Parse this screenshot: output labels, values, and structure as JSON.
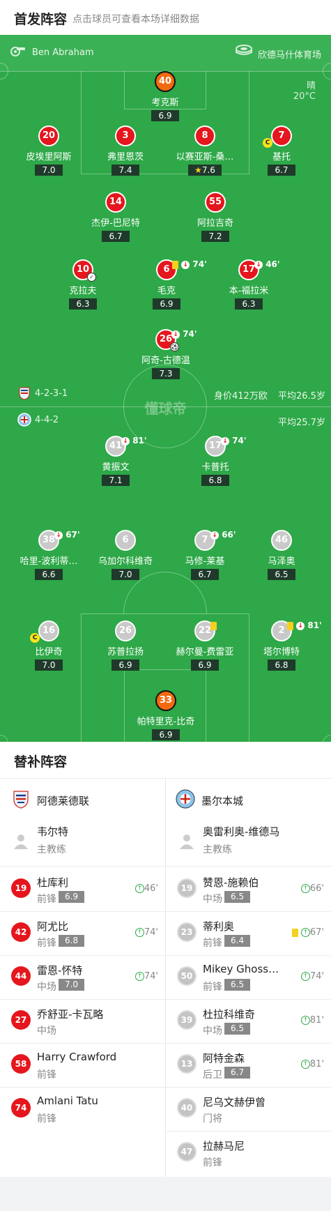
{
  "header": {
    "title": "首发阵容",
    "subtitle": "点击球员可查看本场详细数据"
  },
  "match_info": {
    "referee": "Ben Abraham",
    "venue": "欣德马什体育场",
    "weather": "晴",
    "temperature": "20°C"
  },
  "home": {
    "name": "阿德莱德联",
    "formation": "4-2-3-1",
    "value": "身价412万欧",
    "avg_age": "平均26.5岁",
    "players": [
      {
        "num": "40",
        "name": "考克斯",
        "rating": "6.9"
      },
      {
        "num": "20",
        "name": "皮埃里阿斯",
        "rating": "7.0"
      },
      {
        "num": "3",
        "name": "弗里恩茨",
        "rating": "7.4"
      },
      {
        "num": "8",
        "name": "以赛亚斯-桑…",
        "rating": "7.6"
      },
      {
        "num": "7",
        "name": "基托",
        "rating": "6.7"
      },
      {
        "num": "14",
        "name": "杰伊-巴尼特",
        "rating": "6.7"
      },
      {
        "num": "55",
        "name": "阿拉吉奇",
        "rating": "7.2"
      },
      {
        "num": "10",
        "name": "克拉夫",
        "rating": "6.3"
      },
      {
        "num": "6",
        "name": "毛克",
        "rating": "6.9",
        "event": "74'"
      },
      {
        "num": "17",
        "name": "本-福拉米",
        "rating": "6.3",
        "event": "46'"
      },
      {
        "num": "26",
        "name": "阿奇-古德温",
        "rating": "7.3",
        "event": "74'"
      }
    ]
  },
  "away": {
    "name": "墨尔本城",
    "formation": "4-4-2",
    "avg_age": "平均25.7岁",
    "players": [
      {
        "num": "41",
        "name": "黄振文",
        "rating": "7.1",
        "event": "81'"
      },
      {
        "num": "17",
        "name": "卡普托",
        "rating": "6.8",
        "event": "74'"
      },
      {
        "num": "38",
        "name": "哈里-波利蒂…",
        "rating": "6.6",
        "event": "67'"
      },
      {
        "num": "6",
        "name": "乌加尔科维奇",
        "rating": "7.0"
      },
      {
        "num": "7",
        "name": "马修-莱基",
        "rating": "6.7",
        "event": "66'"
      },
      {
        "num": "46",
        "name": "马泽奥",
        "rating": "6.5"
      },
      {
        "num": "16",
        "name": "比伊奇",
        "rating": "7.0"
      },
      {
        "num": "26",
        "name": "苏普拉扬",
        "rating": "6.9"
      },
      {
        "num": "22",
        "name": "赫尔曼-费雷亚",
        "rating": "6.9"
      },
      {
        "num": "2",
        "name": "塔尔博特",
        "rating": "6.8",
        "event": "81'"
      },
      {
        "num": "33",
        "name": "帕特里克-比奇",
        "rating": "6.9"
      }
    ]
  },
  "watermark": "懂球帝",
  "subs": {
    "title": "替补阵容",
    "home": {
      "team": "阿德莱德联",
      "coach": {
        "name": "韦尔特",
        "role": "主教练"
      },
      "list": [
        {
          "num": "19",
          "name": "杜库利",
          "pos": "前锋",
          "rating": "6.9",
          "minute": "46'"
        },
        {
          "num": "42",
          "name": "阿尤比",
          "pos": "前锋",
          "rating": "6.8",
          "minute": "74'"
        },
        {
          "num": "44",
          "name": "雷恩-怀特",
          "pos": "中场",
          "rating": "7.0",
          "minute": "74'"
        },
        {
          "num": "27",
          "name": "乔舒亚-卡瓦略",
          "pos": "中场",
          "rating": "",
          "minute": ""
        },
        {
          "num": "58",
          "name": "Harry Crawford",
          "pos": "前锋",
          "rating": "",
          "minute": ""
        },
        {
          "num": "74",
          "name": "Amlani Tatu",
          "pos": "前锋",
          "rating": "",
          "minute": ""
        }
      ]
    },
    "away": {
      "team": "墨尔本城",
      "coach": {
        "name": "奥雷利奥-维德马",
        "role": "主教练"
      },
      "list": [
        {
          "num": "19",
          "name": "赞恩-施赖伯",
          "pos": "中场",
          "rating": "6.5",
          "minute": "66'"
        },
        {
          "num": "23",
          "name": "蒂利奥",
          "pos": "前锋",
          "rating": "6.4",
          "minute": "67'"
        },
        {
          "num": "50",
          "name": "Mikey Ghoss…",
          "pos": "前锋",
          "rating": "6.5",
          "minute": "74'"
        },
        {
          "num": "39",
          "name": "杜拉科维奇",
          "pos": "中场",
          "rating": "6.5",
          "minute": "81'"
        },
        {
          "num": "13",
          "name": "阿特金森",
          "pos": "后卫",
          "rating": "6.7",
          "minute": "81'"
        },
        {
          "num": "40",
          "name": "尼乌文赫伊曾",
          "pos": "门将",
          "rating": "",
          "minute": ""
        },
        {
          "num": "47",
          "name": "拉赫马尼",
          "pos": "前锋",
          "rating": "",
          "minute": ""
        }
      ]
    }
  },
  "colors": {
    "pitch": "#2ea848",
    "home": "#e5161d",
    "away": "#c9c9c9",
    "gk": "#f26a10"
  }
}
